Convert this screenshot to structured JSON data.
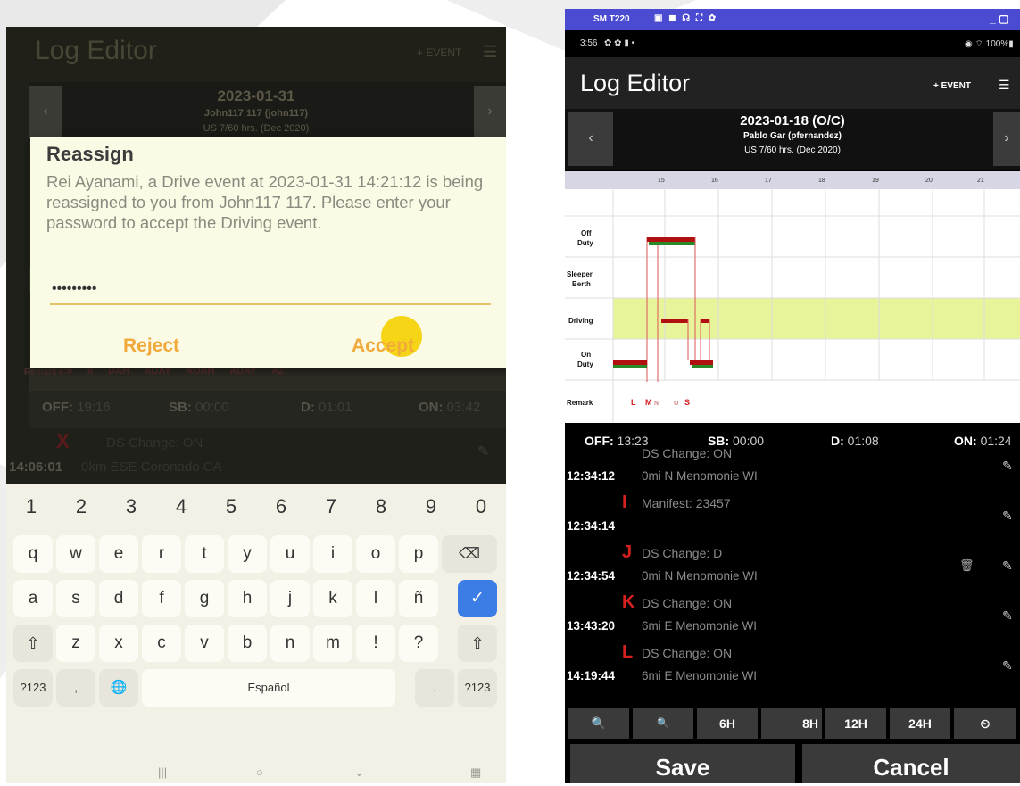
{
  "left": {
    "app_title": "Log Editor",
    "add_event": "+ EVENT",
    "menu_icon": "list-icon",
    "prev": "‹",
    "next": "›",
    "date": "2023-01-31",
    "driver": "John117 117 (john117)",
    "cycle": "US 7/60 hrs. (Dec 2020)",
    "remark_label": "Remark",
    "remark_items": "3:0 8  DAH ADAY  AOAH ADAY  AZ",
    "summary": {
      "off_label": "OFF:",
      "off": "19:16",
      "sb_label": "SB:",
      "sb": "00:00",
      "d_label": "D:",
      "d": "01:01",
      "on_label": "ON:",
      "on": "03:42"
    },
    "event": {
      "letter": "X",
      "desc": "DS Change: ON",
      "time": "14:06:01",
      "loc": "0km ESE Coronado CA"
    },
    "dialog": {
      "title": "Reassign",
      "message": "Rei Ayanami, a Drive event at 2023-01-31 14:21:12 is being reassigned to you from John117 117. Please enter your password to accept the Driving event.",
      "password": "•••••••••",
      "reject": "Reject",
      "accept": "Accept"
    },
    "keyboard": {
      "numbers": [
        "1",
        "2",
        "3",
        "4",
        "5",
        "6",
        "7",
        "8",
        "9",
        "0"
      ],
      "row1": [
        "q",
        "w",
        "e",
        "r",
        "t",
        "y",
        "u",
        "i",
        "o",
        "p"
      ],
      "row2": [
        "a",
        "s",
        "d",
        "f",
        "g",
        "h",
        "j",
        "k",
        "l",
        "ñ"
      ],
      "row3": [
        "z",
        "x",
        "c",
        "v",
        "b",
        "n",
        "m",
        "!",
        "?"
      ],
      "sym_left": "?123",
      "comma": ",",
      "space": "Español",
      "period": ".",
      "sym_right": "?123",
      "backspace": "⌫",
      "enter": "✓",
      "shift": "⇧",
      "globe": "🌐",
      "nav": [
        "|||",
        "○",
        "⌄",
        "▦"
      ]
    }
  },
  "right": {
    "status_left": "SM T220",
    "status_icons": "▣ ◼ ☊ ⛶ ✿",
    "status_window": "_ ▢",
    "time": "3:56",
    "status_right": "◉ ⌔ 100%▮",
    "app_title": "Log Editor",
    "add_event": "+ EVENT",
    "menu_icon": "list-icon",
    "prev": "‹",
    "next": "›",
    "date": "2023-01-18 (O/C)",
    "driver": "Pablo Gar (pfernandez)",
    "cycle": "US 7/60 hrs. (Dec 2020)",
    "hour_ticks": [
      "15",
      "16",
      "17",
      "18",
      "19",
      "20",
      "21"
    ],
    "rows": [
      "Off Duty",
      "Sleeper Berth",
      "Driving",
      "On Duty",
      "Remark"
    ],
    "remark_marks": [
      "L",
      "M",
      "N",
      "O",
      "S"
    ],
    "summary": {
      "off_label": "OFF:",
      "off": "13:23",
      "sb_label": "SB:",
      "sb": "00:00",
      "d_label": "D:",
      "d": "01:08",
      "on_label": "ON:",
      "on": "01:24"
    },
    "events": [
      {
        "letter": "",
        "desc": "DS Change: ON",
        "time": "12:34:12",
        "loc": "0mi N Menomonie WI",
        "trash": false
      },
      {
        "letter": "I",
        "desc": "Manifest: 23457",
        "time": "12:34:14",
        "loc": "",
        "trash": false
      },
      {
        "letter": "J",
        "desc": "DS Change: D",
        "time": "12:34:54",
        "loc": "0mi N Menomonie WI",
        "trash": true
      },
      {
        "letter": "K",
        "desc": "DS Change: ON",
        "time": "13:43:20",
        "loc": "6mi E Menomonie WI",
        "trash": false
      },
      {
        "letter": "L",
        "desc": "DS Change: ON",
        "time": "14:19:44",
        "loc": "6mi E Menomonie WI",
        "trash": false
      }
    ],
    "zoom_buttons": [
      "🔍",
      "🔍",
      "6H",
      "8H",
      "12H",
      "24H",
      "⏲"
    ],
    "save": "Save",
    "cancel": "Cancel"
  }
}
